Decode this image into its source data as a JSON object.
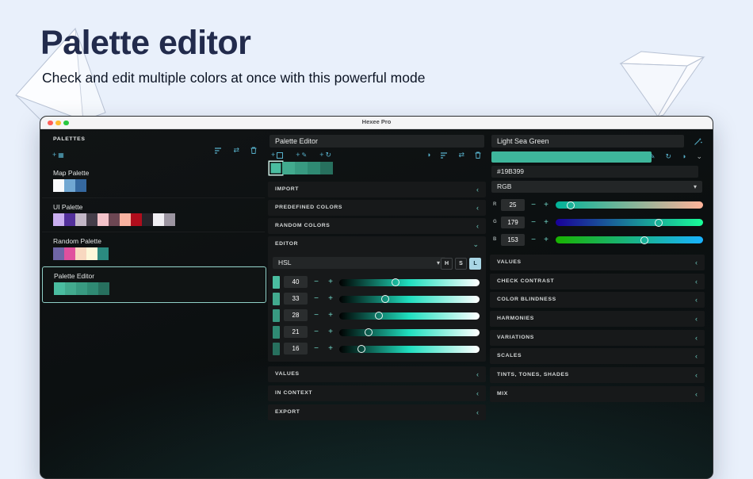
{
  "page": {
    "title": "Palette editor",
    "subtitle": "Check and edit multiple colors at once with this powerful mode"
  },
  "window": {
    "title": "Hexee Pro"
  },
  "icons": {
    "plus": "+",
    "minus": "−",
    "grid": "▦",
    "swap": "⇄",
    "contrast": "◑",
    "refresh": "↻",
    "pen": "✎",
    "chevron_collapsed": "‹",
    "chevron_expanded": "⌄",
    "caret_down": "▾",
    "chevron_down_small": "⌄"
  },
  "sidebar": {
    "header": "PALETTES",
    "palettes": [
      {
        "name": "Map Palette",
        "colors": [
          "#f9fafc",
          "#71a7d2",
          "#35689f"
        ]
      },
      {
        "name": "UI Palette",
        "colors": [
          "#c9aef0",
          "#53309b",
          "#c3b7c7",
          "#453e4a",
          "#f4c3ca",
          "#6d4753",
          "#f8b2a0",
          "#b00d1c",
          "#27242a",
          "#f1eff3",
          "#9c95a1"
        ]
      },
      {
        "name": "Random Palette",
        "colors": [
          "#6f66a6",
          "#e0509e",
          "#f8d8c0",
          "#fcf8da",
          "#2b8a80"
        ]
      },
      {
        "name": "Palette Editor",
        "colors": [
          "#4abda0",
          "#42aa8e",
          "#389a81",
          "#2f8a73",
          "#27705e"
        ],
        "selected": true
      }
    ]
  },
  "middle": {
    "palette_name_input": "Palette Editor",
    "strip_colors": [
      "#4abda0",
      "#42aa8e",
      "#389a81",
      "#2f8a73",
      "#27705e"
    ],
    "sections": {
      "import": "IMPORT",
      "predefined": "PREDEFINED COLORS",
      "random": "RANDOM COLORS",
      "editor": "EDITOR",
      "values": "VALUES",
      "in_context": "IN CONTEXT",
      "export": "EXPORT"
    },
    "editor": {
      "mode": "HSL",
      "toggles": {
        "h": "H",
        "s": "S",
        "l": "L"
      },
      "active_toggle": "L",
      "track_gradient": "linear-gradient(90deg,#000000 0%,#19b399 40%,#20dfbf 50%,#ffffff 100%)",
      "sliders": [
        {
          "value": "40",
          "pos": "40%",
          "swatch": "#4abda0"
        },
        {
          "value": "33",
          "pos": "33%",
          "swatch": "#42aa8e"
        },
        {
          "value": "28",
          "pos": "28%",
          "swatch": "#389a81"
        },
        {
          "value": "21",
          "pos": "21%",
          "swatch": "#2f8a73"
        },
        {
          "value": "16",
          "pos": "16%",
          "swatch": "#27705e"
        }
      ]
    }
  },
  "right": {
    "color_name_input": "Light Sea Green",
    "swatch_color": "#3eb69b",
    "hex_input": "#19B399",
    "mode_select": "RGB",
    "channels": [
      {
        "label": "R",
        "value": "25",
        "pos": "10%",
        "gradient": "linear-gradient(90deg,#00b399,#ffb399)"
      },
      {
        "label": "G",
        "value": "179",
        "pos": "70%",
        "gradient": "linear-gradient(90deg,#190099,#19ff99)"
      },
      {
        "label": "B",
        "value": "153",
        "pos": "60%",
        "gradient": "linear-gradient(90deg,#19b300,#19b3ff)"
      }
    ],
    "sections": {
      "values": "VALUES",
      "check_contrast": "CHECK CONTRAST",
      "color_blindness": "COLOR BLINDNESS",
      "harmonies": "HARMONIES",
      "variations": "VARIATIONS",
      "scales": "SCALES",
      "tints": "TINTS, TONES, SHADES",
      "mix": "MIX"
    }
  },
  "colors": {
    "accent_teal": "#57b0ca",
    "selection_border": "#8fd0c7",
    "page_bg": "#e9f0fb",
    "heading": "#222b4c"
  }
}
